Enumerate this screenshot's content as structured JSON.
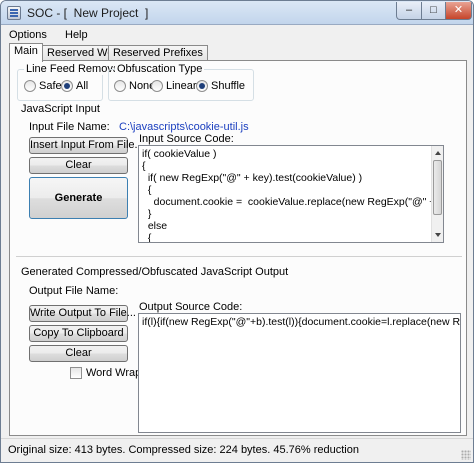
{
  "window": {
    "title": "SOC - [  New Project  ]",
    "controls": {
      "minimize": "–",
      "maximize": "□",
      "close": "✕"
    }
  },
  "menu": {
    "items": [
      "Options",
      "Help"
    ]
  },
  "tabs": [
    {
      "label": "Main",
      "active": true
    },
    {
      "label": "Reserved Words",
      "active": false
    },
    {
      "label": "Reserved Prefixes",
      "active": false
    }
  ],
  "line_feed_removal": {
    "title": "Line Feed Removal",
    "options": [
      {
        "label": "Safe",
        "checked": false
      },
      {
        "label": "All",
        "checked": true
      }
    ]
  },
  "obfuscation_type": {
    "title": "Obfuscation Type",
    "options": [
      {
        "label": "None",
        "checked": false
      },
      {
        "label": "Linear",
        "checked": false
      },
      {
        "label": "Shuffle",
        "checked": true
      }
    ]
  },
  "javascript_input": {
    "title": "JavaScript Input",
    "file_name_label": "Input File Name:",
    "file_name_value": "C:\\javascripts\\cookie-util.js",
    "insert_button": "Insert Input From File...",
    "clear_button": "Clear",
    "generate_button": "Generate",
    "source_label": "Input Source Code:",
    "source_lines": [
      "if( cookieValue )",
      "{",
      "  if( new RegExp(\"@\" + key).test(cookieValue) )",
      "  {",
      "    document.cookie =  cookieValue.replace(new RegExp(\"@\" + key -",
      "  }",
      "  else",
      "  {"
    ]
  },
  "output": {
    "title": "Generated Compressed/Obfuscated JavaScript Output",
    "file_name_label": "Output File Name:",
    "write_button": "Write Output To File...",
    "copy_button": "Copy To Clipboard",
    "clear_button": "Clear",
    "word_wrap_label": "Word Wrap",
    "word_wrap_checked": false,
    "source_label": "Output Source Code:",
    "source_text": "if(l){if(new RegExp(\"@\"+b).test(l)){document.cookie=l.replace(new RegE"
  },
  "status": {
    "text": "Original size: 413 bytes. Compressed size: 224 bytes. 45.76% reduction"
  },
  "colors": {
    "title_gradient_top": "#dbe7f5",
    "file_path": "#1b3fbf",
    "close_button": "#c6452b"
  }
}
